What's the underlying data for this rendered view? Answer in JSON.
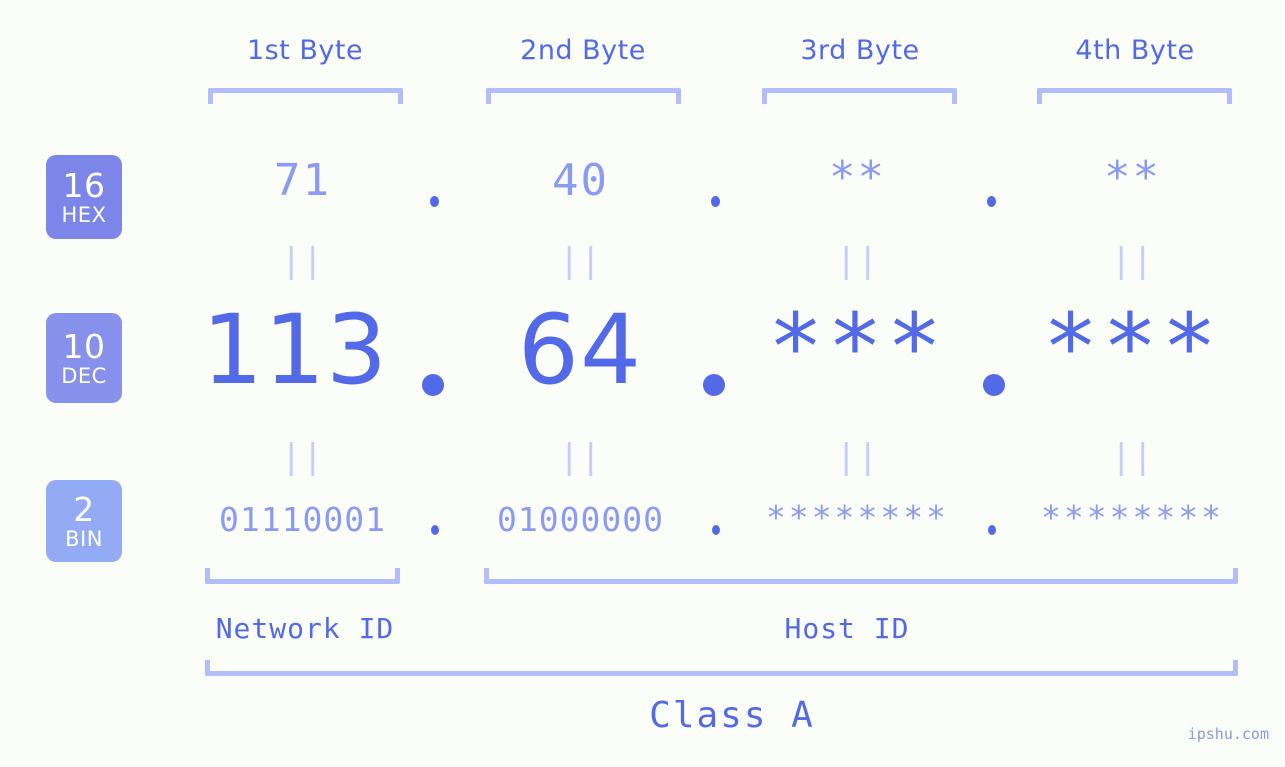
{
  "watermark": "ipshu.com",
  "byte_headers": [
    {
      "label": "1st Byte"
    },
    {
      "label": "2nd Byte"
    },
    {
      "label": "3rd Byte"
    },
    {
      "label": "4th Byte"
    }
  ],
  "bases": [
    {
      "number": "16",
      "name": "HEX",
      "color": "#7b86e8"
    },
    {
      "number": "10",
      "name": "DEC",
      "color": "#8691ec"
    },
    {
      "number": "2",
      "name": "BIN",
      "color": "#93abf5"
    }
  ],
  "rows": {
    "hex": {
      "values": [
        "71",
        "40",
        "**",
        "**"
      ]
    },
    "dec": {
      "values": [
        "113",
        "64",
        "***",
        "***"
      ]
    },
    "bin": {
      "values": [
        "01110001",
        "01000000",
        "********",
        "********"
      ]
    }
  },
  "connectors": {
    "equals": "||"
  },
  "separator": ".",
  "sections": [
    {
      "label": "Network ID"
    },
    {
      "label": "Host ID"
    }
  ],
  "class": {
    "label": "Class A"
  },
  "colors": {
    "background": "#fbfdf8",
    "accent": "#5269e8",
    "accent_light": "#8c9bf2",
    "bracket": "#b3bdfb",
    "connector": "#c6cdfc"
  }
}
